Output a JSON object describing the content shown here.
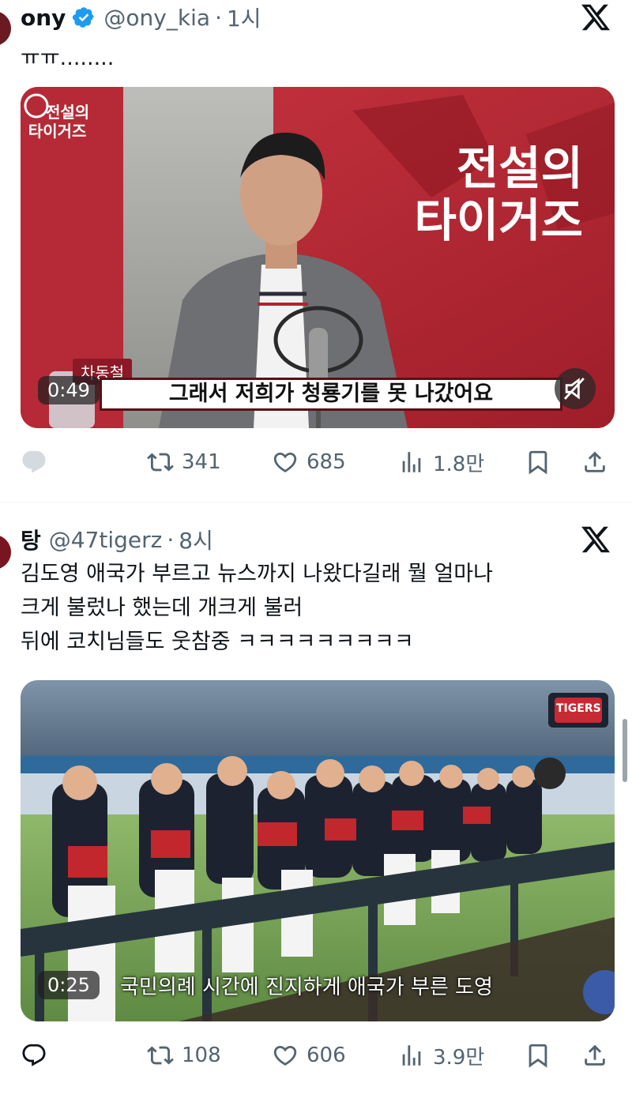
{
  "tweets": [
    {
      "name": "ony",
      "handle": "@ony_kia",
      "separator": "·",
      "time": "1시",
      "text": "ㅠㅠ........",
      "media": {
        "brand_top": "전설의",
        "brand_bottom": "타이거즈",
        "small_brand_top": "전설의",
        "small_brand_bottom": "타이거즈",
        "person_tag": "차동철",
        "duration": "0:49",
        "subtitle": "그래서 저희가 청룡기를 못 나갔어요"
      },
      "stats": {
        "replies": "",
        "retweets": "341",
        "likes": "685",
        "views": "1.8만"
      }
    },
    {
      "name": "탕",
      "handle": "@47tigerz",
      "separator": "·",
      "time": "8시",
      "text": "김도영 애국가 부르고 뉴스까지 나왔다길래 뭘 얼마나\n크게 불렀나 했는데 개크게 불러\n뒤에 코치님들도 웃참중 ㅋㅋㅋㅋㅋㅋㅋㅋㅋ",
      "media": {
        "team_logo": "TIGERS",
        "duration": "0:25",
        "caption": "국민의례 시간에 진지하게 애국가 부른 도영"
      },
      "stats": {
        "replies": "",
        "retweets": "108",
        "likes": "606",
        "views": "3.9만"
      }
    }
  ],
  "icons": {
    "verified": "verified-badge-icon",
    "platform": "x-logo-icon",
    "reply": "reply-icon",
    "retweet": "retweet-icon",
    "like": "heart-icon",
    "views": "views-icon",
    "bookmark": "bookmark-icon",
    "share": "share-icon"
  },
  "colors": {
    "verified": "#1d9bf0",
    "text_secondary": "#536471",
    "tigers_red": "#b3222f"
  }
}
